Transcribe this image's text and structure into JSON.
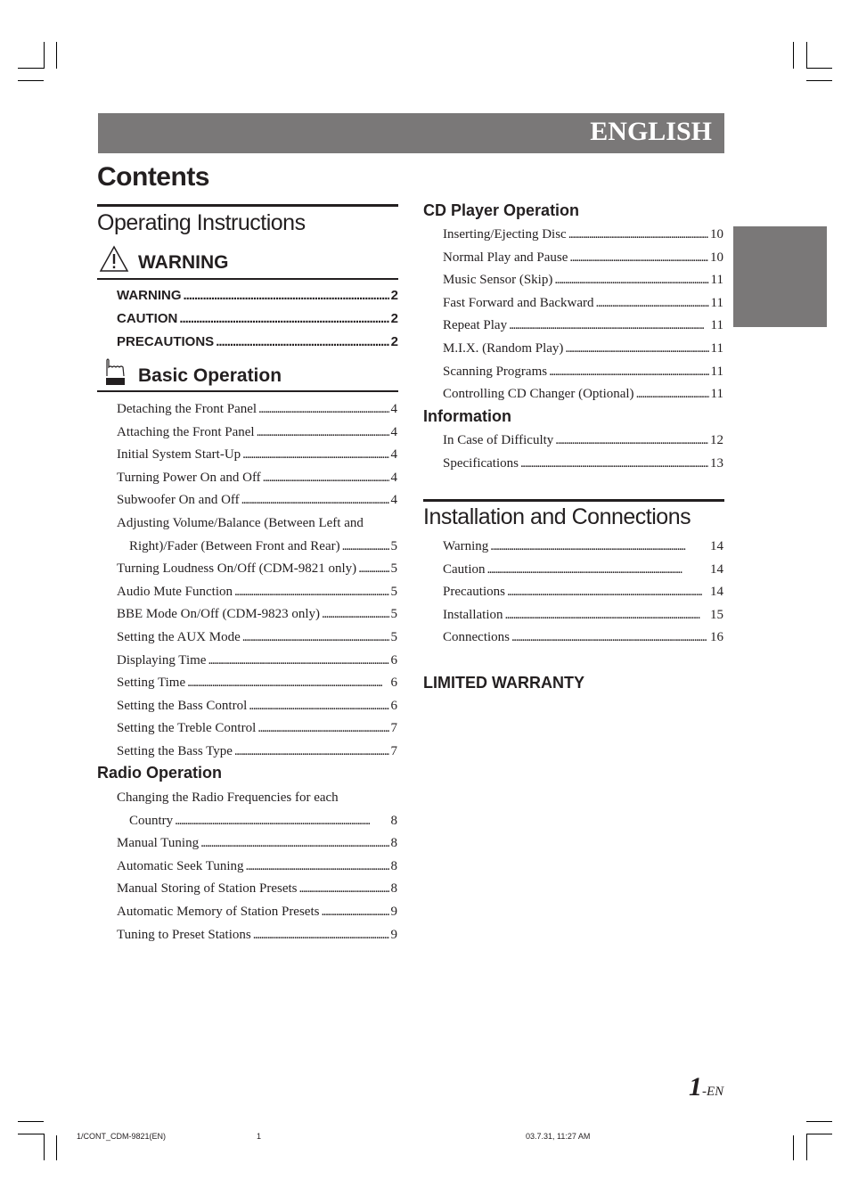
{
  "banner": {
    "language": "ENGLISH"
  },
  "title": "Contents",
  "left_column": {
    "operating_instructions": {
      "title": "Operating Instructions",
      "warning_section": {
        "title": "WARNING",
        "icon": "warning-triangle-icon",
        "items": [
          {
            "label": "WARNING",
            "page": "2"
          },
          {
            "label": "CAUTION",
            "page": "2"
          },
          {
            "label": "PRECAUTIONS",
            "page": "2"
          }
        ]
      },
      "basic_operation": {
        "title": "Basic Operation",
        "icon": "hand-pointer-icon",
        "items": [
          {
            "label": "Detaching the Front Panel",
            "page": "4"
          },
          {
            "label": "Attaching the Front Panel",
            "page": "4"
          },
          {
            "label": "Initial System Start-Up",
            "page": "4"
          },
          {
            "label": "Turning Power On and Off",
            "page": "4"
          },
          {
            "label": "Subwoofer On and Off",
            "page": "4"
          },
          {
            "label": "Adjusting Volume/Balance (Between Left and",
            "page": ""
          },
          {
            "label": "Right)/Fader (Between Front and Rear)",
            "page": "5"
          },
          {
            "label": "Turning Loudness On/Off (CDM-9821 only)",
            "page": "5"
          },
          {
            "label": "Audio Mute Function",
            "page": "5"
          },
          {
            "label": "BBE Mode On/Off (CDM-9823 only)",
            "page": "5"
          },
          {
            "label": "Setting the AUX Mode",
            "page": "5"
          },
          {
            "label": "Displaying Time",
            "page": "6"
          },
          {
            "label": "Setting Time",
            "page": "6"
          },
          {
            "label": "Setting the Bass Control",
            "page": "6"
          },
          {
            "label": "Setting the Treble Control",
            "page": "7"
          },
          {
            "label": "Setting the Bass Type",
            "page": "7"
          }
        ]
      },
      "radio_operation": {
        "title": "Radio Operation",
        "items": [
          {
            "label": "Changing the Radio Frequencies for each",
            "page": ""
          },
          {
            "label": "Country",
            "page": "8"
          },
          {
            "label": "Manual Tuning",
            "page": "8"
          },
          {
            "label": "Automatic Seek Tuning",
            "page": "8"
          },
          {
            "label": "Manual Storing of Station Presets",
            "page": "8"
          },
          {
            "label": "Automatic Memory of Station Presets",
            "page": "9"
          },
          {
            "label": "Tuning to Preset Stations",
            "page": "9"
          }
        ]
      }
    }
  },
  "right_column": {
    "cd_player_operation": {
      "title": "CD Player Operation",
      "items": [
        {
          "label": "Inserting/Ejecting Disc",
          "page": "10"
        },
        {
          "label": "Normal Play and Pause",
          "page": "10"
        },
        {
          "label": "Music Sensor (Skip)",
          "page": "11"
        },
        {
          "label": "Fast Forward and Backward",
          "page": "11"
        },
        {
          "label": "Repeat Play",
          "page": "11"
        },
        {
          "label": "M.I.X. (Random Play)",
          "page": "11"
        },
        {
          "label": "Scanning Programs",
          "page": "11"
        },
        {
          "label": "Controlling CD Changer (Optional)",
          "page": "11"
        }
      ]
    },
    "information": {
      "title": "Information",
      "items": [
        {
          "label": "In Case of Difficulty",
          "page": "12"
        },
        {
          "label": "Specifications",
          "page": "13"
        }
      ]
    },
    "installation": {
      "title": "Installation and Connections",
      "items": [
        {
          "label": "Warning",
          "page": "14"
        },
        {
          "label": "Caution",
          "page": "14"
        },
        {
          "label": "Precautions",
          "page": "14"
        },
        {
          "label": "Installation",
          "page": "15"
        },
        {
          "label": "Connections",
          "page": "16"
        }
      ]
    },
    "limited_warranty": {
      "title": "LIMITED WARRANTY"
    }
  },
  "page_number": {
    "number": "1",
    "suffix": "-EN"
  },
  "footer": {
    "file": "1/CONT_CDM-9821(EN)",
    "sheet": "1",
    "timestamp": "03.7.31, 11:27 AM"
  },
  "colors": {
    "banner": "#7a7878",
    "text": "#231f20"
  }
}
